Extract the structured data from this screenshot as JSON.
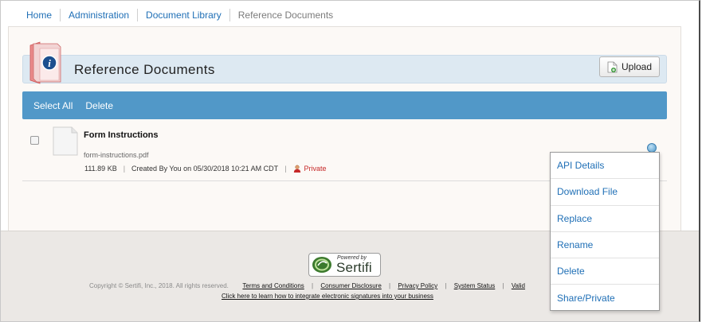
{
  "breadcrumb": {
    "items": [
      "Home",
      "Administration",
      "Document Library"
    ],
    "current": "Reference Documents"
  },
  "page": {
    "title": "Reference Documents",
    "upload_label": "Upload"
  },
  "actions": {
    "select_all": "Select All",
    "delete": "Delete"
  },
  "document": {
    "title": "Form Instructions",
    "filename": "form-instructions.pdf",
    "size": "111.89 KB",
    "created": "Created By You on 05/30/2018 10:21 AM CDT",
    "visibility": "Private"
  },
  "menu": {
    "items": [
      "API Details",
      "Download File",
      "Replace",
      "Rename",
      "Delete",
      "Share/Private"
    ]
  },
  "footer": {
    "powered_by": "Powered by",
    "brand": "Sertifi",
    "copyright": "Copyright © Sertifi, Inc., 2018. All rights reserved.",
    "links": [
      "Terms and Conditions",
      "Consumer Disclosure",
      "Privacy Policy",
      "System Status",
      "Valid"
    ],
    "cta": "Click here to learn how to integrate electronic signatures into your business"
  },
  "colors": {
    "link": "#1f6fb6",
    "action_bar": "#5198c8",
    "private": "#c62828"
  }
}
